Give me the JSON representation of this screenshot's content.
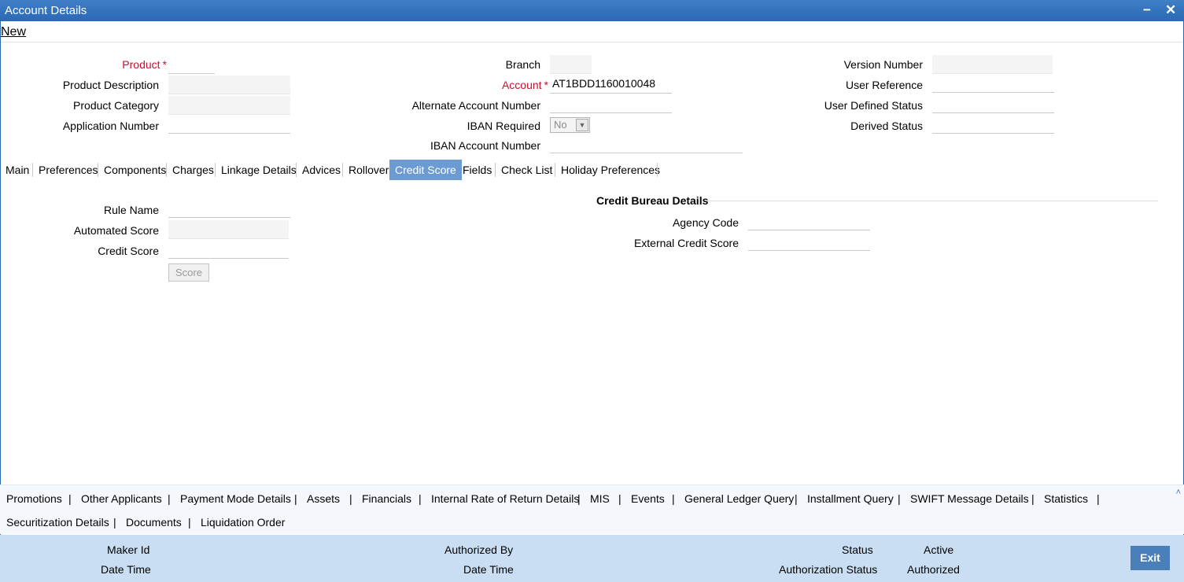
{
  "window": {
    "title": "Account Details",
    "minimize_glyph": "−",
    "close_glyph": "✕"
  },
  "menu": {
    "new_label": "New"
  },
  "form": {
    "product_label": "Product",
    "product_value": "",
    "product_description_label": "Product Description",
    "product_category_label": "Product Category",
    "application_number_label": "Application Number",
    "branch_label": "Branch",
    "account_label": "Account",
    "account_value": "AT1BDD1160010048",
    "alternate_account_number_label": "Alternate Account Number",
    "iban_required_label": "IBAN Required",
    "iban_required_value": "No",
    "iban_account_number_label": "IBAN Account Number",
    "version_number_label": "Version Number",
    "user_reference_label": "User Reference",
    "user_defined_status_label": "User Defined Status",
    "derived_status_label": "Derived Status",
    "required_marker": "*"
  },
  "tabs": [
    {
      "label": "Main"
    },
    {
      "label": "Preferences"
    },
    {
      "label": "Components"
    },
    {
      "label": "Charges"
    },
    {
      "label": "Linkage Details"
    },
    {
      "label": "Advices"
    },
    {
      "label": "Rollover"
    },
    {
      "label": "Credit Score",
      "active": true
    },
    {
      "label": "Fields"
    },
    {
      "label": "Check List"
    },
    {
      "label": "Holiday Preferences"
    }
  ],
  "credit_score": {
    "rule_name_label": "Rule Name",
    "automated_score_label": "Automated Score",
    "credit_score_label": "Credit Score",
    "score_button": "Score",
    "bureau_title": "Credit Bureau Details",
    "agency_code_label": "Agency Code",
    "external_credit_score_label": "External Credit Score"
  },
  "bottom_links": [
    "Promotions",
    "Other Applicants",
    "Payment Mode Details",
    "Assets",
    "Financials",
    "Internal Rate of Return Details",
    "MIS",
    "Events",
    "General Ledger Query",
    "Installment Query",
    "SWIFT Message Details",
    "Statistics",
    "Securitization Details",
    "Documents",
    "Liquidation Order"
  ],
  "separator": "|",
  "scroll_up_glyph": "˄",
  "select_arrow_glyph": "▼",
  "footer": {
    "maker_id_label": "Maker Id",
    "date_time_label": "Date Time",
    "authorized_by_label": "Authorized By",
    "status_label": "Status",
    "status_value": "Active",
    "authorization_status_label": "Authorization Status",
    "authorization_status_value": "Authorized",
    "exit_button": "Exit"
  },
  "colors": {
    "titlebar": "#2a68b4",
    "required": "#c8102e",
    "active_tab": "#6b9bd2",
    "footer_bg": "#c9def2",
    "exit_button": "#4a7fba"
  }
}
